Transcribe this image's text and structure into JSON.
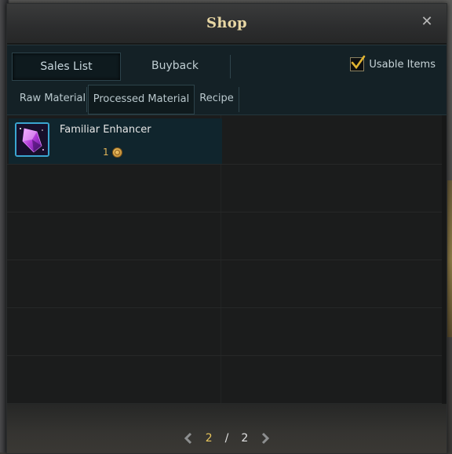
{
  "window": {
    "title": "Shop"
  },
  "tabs": {
    "sales_list": "Sales List",
    "buyback": "Buyback"
  },
  "usable_items": {
    "label": "Usable Items",
    "checked": true
  },
  "subtabs": [
    {
      "label": "Raw Material",
      "active": false
    },
    {
      "label": "Processed Material",
      "active": true
    },
    {
      "label": "Recipe",
      "active": false
    }
  ],
  "items": [
    {
      "name": "Familiar Enhancer",
      "price": "1",
      "icon": "purple-crystal-icon"
    }
  ],
  "pagination": {
    "current": "2",
    "separator": "/",
    "total": "2"
  },
  "colors": {
    "title_gold": "#e8d7a4",
    "price_gold": "#e2b559",
    "page_current": "#e6c45c",
    "icon_border": "#3aa5d0"
  }
}
